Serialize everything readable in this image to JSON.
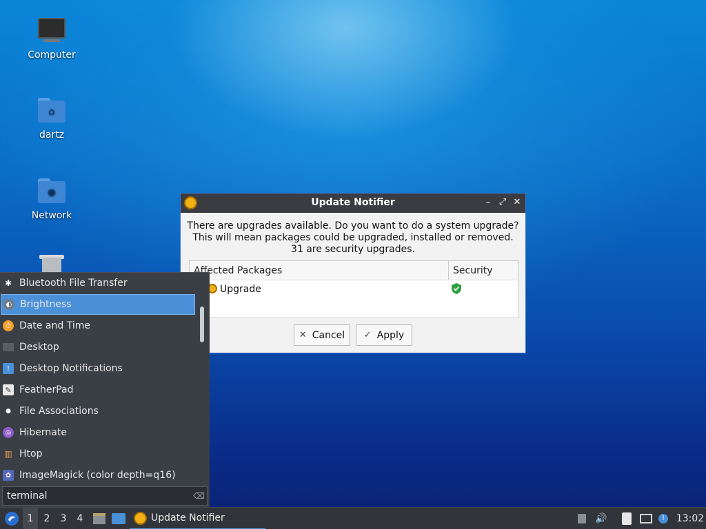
{
  "desktop": {
    "icons": [
      {
        "label": "Computer",
        "icon": "computer-icon"
      },
      {
        "label": "dartz",
        "icon": "home-folder-icon"
      },
      {
        "label": "Network",
        "icon": "network-folder-icon"
      },
      {
        "label": "",
        "icon": "trash-icon"
      }
    ]
  },
  "dialog": {
    "title": "Update Notifier",
    "message_line1": "There are upgrades available. Do you want to do a system upgrade?",
    "message_line2": "This will mean packages could be upgraded, installed or removed.",
    "message_line3": "31 are security upgrades.",
    "table": {
      "col_packages": "Affected Packages",
      "col_security": "Security",
      "rows": [
        {
          "package": "Upgrade",
          "security_icon": "shield-check-icon"
        }
      ]
    },
    "cancel_label": "Cancel",
    "apply_label": "Apply",
    "colors": {
      "titlebar": "#3a3c42",
      "accent": "#3a74c8",
      "shield": "#2ea043"
    }
  },
  "menu": {
    "items": [
      {
        "label": "Bluetooth File Transfer",
        "icon": "bluetooth-icon"
      },
      {
        "label": "Brightness",
        "icon": "brightness-icon"
      },
      {
        "label": "Date and Time",
        "icon": "clock-icon"
      },
      {
        "label": "Desktop",
        "icon": "desktop-icon"
      },
      {
        "label": "Desktop Notifications",
        "icon": "notification-icon"
      },
      {
        "label": "FeatherPad",
        "icon": "featherpad-icon"
      },
      {
        "label": "File Associations",
        "icon": "file-associations-icon"
      },
      {
        "label": "Hibernate",
        "icon": "hibernate-icon"
      },
      {
        "label": "Htop",
        "icon": "htop-icon"
      },
      {
        "label": "ImageMagick (color depth=q16)",
        "icon": "imagemagick-icon"
      }
    ],
    "selected": "Brightness",
    "search_value": "terminal"
  },
  "taskbar": {
    "workspaces": [
      "1",
      "2",
      "3",
      "4"
    ],
    "active_workspace": "1",
    "task_label": "Update Notifier",
    "clock": "13:02"
  }
}
